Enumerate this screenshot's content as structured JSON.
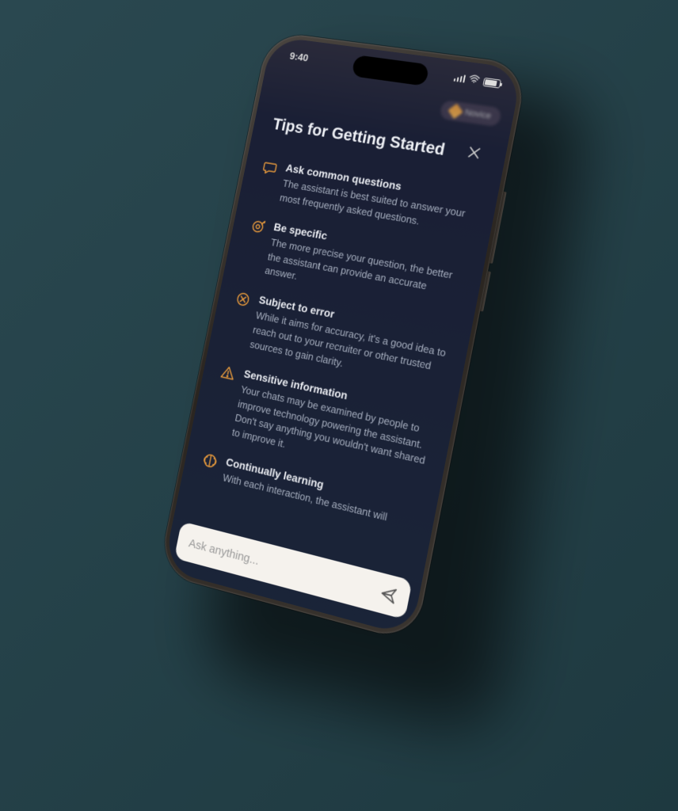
{
  "status": {
    "time": "9:40"
  },
  "badge": {
    "label": "Novice"
  },
  "header": {
    "title": "Tips for Getting Started"
  },
  "tips": [
    {
      "icon": "speech-bubble-icon",
      "title": "Ask common questions",
      "desc": "The assistant is best suited to answer your most frequently asked questions."
    },
    {
      "icon": "target-icon",
      "title": "Be specific",
      "desc": "The more precise your question, the better the assistant can provide an accurate answer."
    },
    {
      "icon": "error-circle-icon",
      "title": "Subject to error",
      "desc": "While it aims for accuracy, it's a good idea to reach out to your recruiter or other trusted sources to gain clarity."
    },
    {
      "icon": "warning-triangle-icon",
      "title": "Sensitive information",
      "desc": "Your chats may be examined by people to improve technology powering the assistant. Don't say anything you wouldn't want shared to improve it."
    },
    {
      "icon": "brain-icon",
      "title": "Continually learning",
      "desc": "With each interaction, the assistant will"
    }
  ],
  "input": {
    "placeholder": "Ask anything..."
  }
}
